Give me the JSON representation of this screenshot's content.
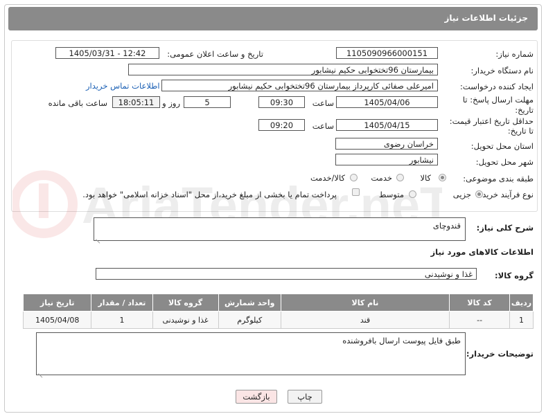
{
  "header": {
    "title": "جزئیات اطلاعات نیاز"
  },
  "fields": {
    "need_number_label": "شماره نیاز:",
    "need_number": "1105090966000151",
    "announce_label": "تاریخ و ساعت اعلان عمومی:",
    "announce_value": "1405/03/31 - 12:42",
    "buyer_org_label": "نام دستگاه خریدار:",
    "buyer_org": "بیمارستان 96تختخوابی حکیم نیشابور",
    "creator_label": "ایجاد کننده درخواست:",
    "creator": "امیرعلی صفائی کارپرداز بیمارستان 96تختخوابی حکیم نیشابور",
    "contact_link": "اطلاعات تماس خریدار",
    "deadline_label": "مهلت ارسال پاسخ: تا تاریخ:",
    "deadline_date": "1405/04/06",
    "time_label": "ساعت",
    "deadline_time": "09:30",
    "days_value": "5",
    "days_label": "روز و",
    "remaining_time": "18:05:11",
    "remaining_label": "ساعت باقی مانده",
    "price_validity_label": "حداقل تاریخ اعتبار قیمت: تا تاریخ:",
    "price_validity_date": "1405/04/15",
    "price_validity_time": "09:20",
    "province_label": "استان محل تحویل:",
    "province": "خراسان رضوی",
    "city_label": "شهر محل تحویل:",
    "city": "نیشابور",
    "category_label": "طبقه بندی موضوعی:",
    "category_options": [
      "کالا",
      "خدمت",
      "کالا/خدمت"
    ],
    "process_label": "نوع فرآیند خرید :",
    "process_options": [
      "جزیی",
      "متوسط"
    ],
    "payment_note": "پرداخت تمام یا بخشی از مبلغ خرید،از محل \"اسناد خزانه اسلامی\" خواهد بود."
  },
  "description": {
    "label": "شرح کلی نیاز:",
    "value": "قندوچای"
  },
  "goods_info_title": "اطلاعات کالاهای مورد نیاز",
  "goods_group": {
    "label": "گروه کالا:",
    "value": "غذا و نوشیدنی"
  },
  "table": {
    "headers": [
      "ردیف",
      "کد کالا",
      "نام کالا",
      "واحد شمارش",
      "گروه کالا",
      "تعداد / مقدار",
      "تاریخ نیاز"
    ],
    "rows": [
      [
        "1",
        "--",
        "قند",
        "کیلوگرم",
        "غذا و نوشیدنی",
        "1",
        "1405/04/08"
      ]
    ]
  },
  "buyer_notes": {
    "label": "توضیحات خریدار:",
    "value": "طبق  فایل پیوست ارسال بافروشنده"
  },
  "buttons": {
    "print": "چاپ",
    "back": "بازگشت"
  },
  "watermark": "AriaTender.neT"
}
